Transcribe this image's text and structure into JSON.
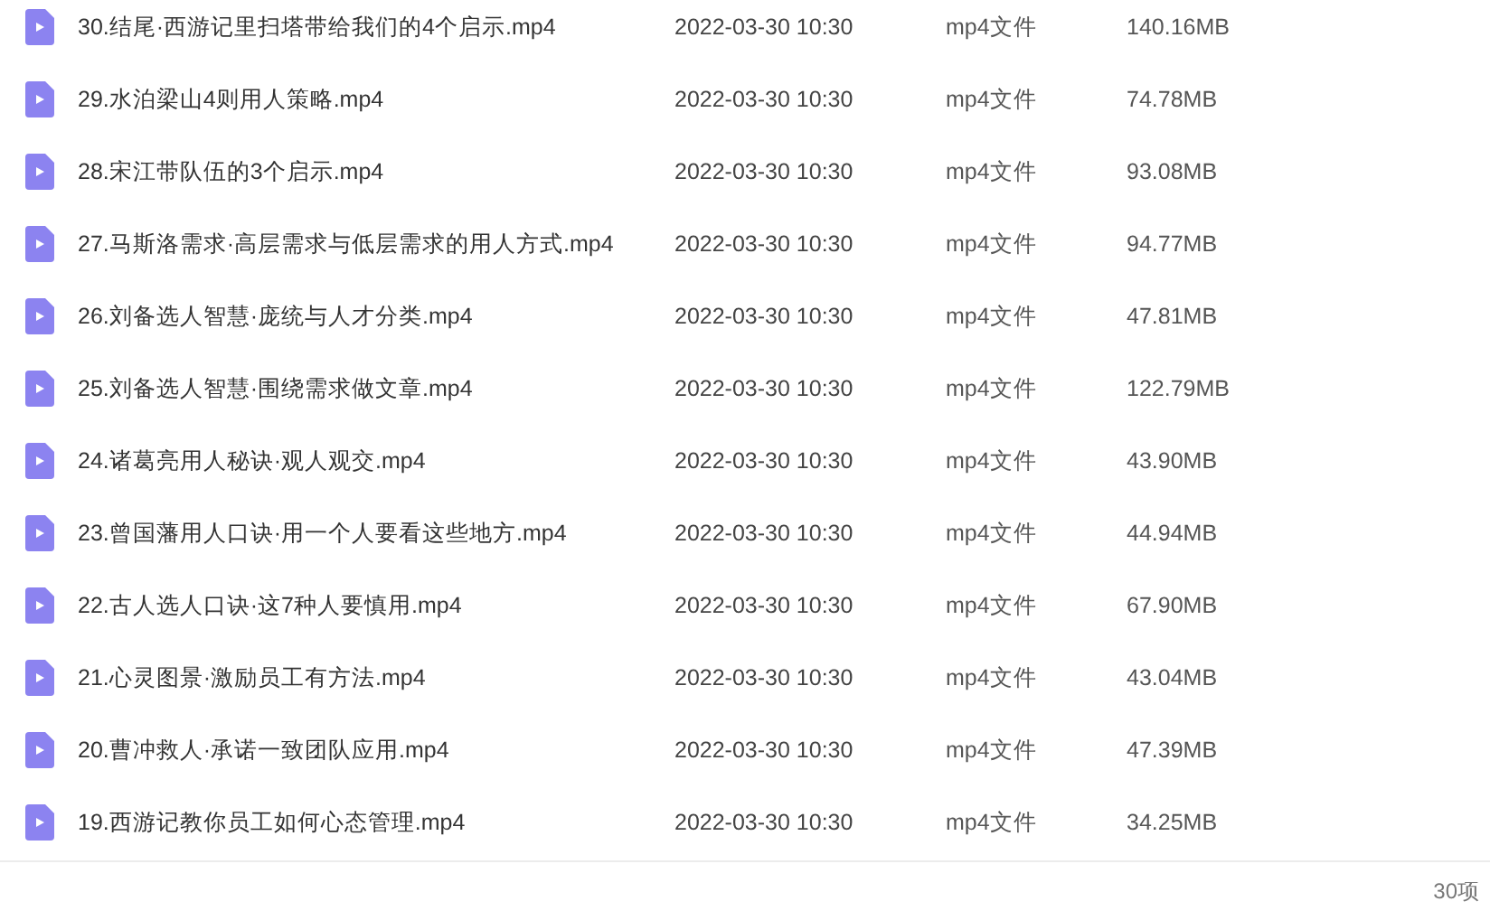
{
  "files": [
    {
      "name": "30.结尾·西游记里扫塔带给我们的4个启示.mp4",
      "modified": "2022-03-30 10:30",
      "type": "mp4文件",
      "size": "140.16MB"
    },
    {
      "name": "29.水泊梁山4则用人策略.mp4",
      "modified": "2022-03-30 10:30",
      "type": "mp4文件",
      "size": "74.78MB"
    },
    {
      "name": "28.宋江带队伍的3个启示.mp4",
      "modified": "2022-03-30 10:30",
      "type": "mp4文件",
      "size": "93.08MB"
    },
    {
      "name": "27.马斯洛需求·高层需求与低层需求的用人方式.mp4",
      "modified": "2022-03-30 10:30",
      "type": "mp4文件",
      "size": "94.77MB"
    },
    {
      "name": "26.刘备选人智慧·庞统与人才分类.mp4",
      "modified": "2022-03-30 10:30",
      "type": "mp4文件",
      "size": "47.81MB"
    },
    {
      "name": "25.刘备选人智慧·围绕需求做文章.mp4",
      "modified": "2022-03-30 10:30",
      "type": "mp4文件",
      "size": "122.79MB"
    },
    {
      "name": "24.诸葛亮用人秘诀·观人观交.mp4",
      "modified": "2022-03-30 10:30",
      "type": "mp4文件",
      "size": "43.90MB"
    },
    {
      "name": "23.曾国藩用人口诀·用一个人要看这些地方.mp4",
      "modified": "2022-03-30 10:30",
      "type": "mp4文件",
      "size": "44.94MB"
    },
    {
      "name": "22.古人选人口诀·这7种人要慎用.mp4",
      "modified": "2022-03-30 10:30",
      "type": "mp4文件",
      "size": "67.90MB"
    },
    {
      "name": "21.心灵图景·激励员工有方法.mp4",
      "modified": "2022-03-30 10:30",
      "type": "mp4文件",
      "size": "43.04MB"
    },
    {
      "name": "20.曹冲救人·承诺一致团队应用.mp4",
      "modified": "2022-03-30 10:30",
      "type": "mp4文件",
      "size": "47.39MB"
    },
    {
      "name": "19.西游记教你员工如何心态管理.mp4",
      "modified": "2022-03-30 10:30",
      "type": "mp4文件",
      "size": "34.25MB"
    }
  ],
  "status_bar": {
    "count": "30项"
  }
}
